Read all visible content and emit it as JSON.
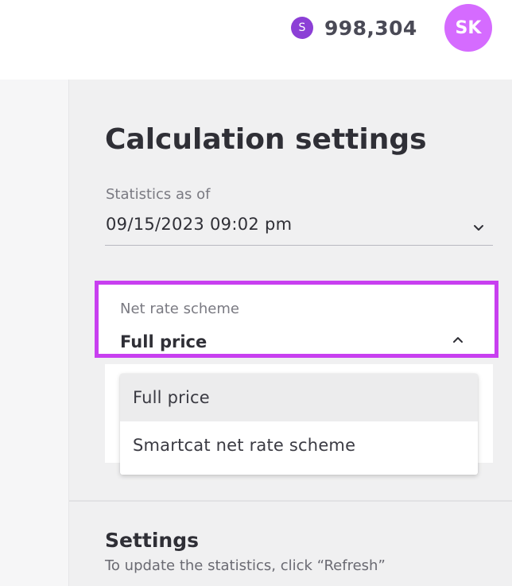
{
  "header": {
    "coin_symbol": "S",
    "balance": "998,304",
    "avatar_initials": "SK"
  },
  "panel": {
    "title": "Calculation settings",
    "statistics": {
      "label": "Statistics as of",
      "value": "09/15/2023 09:02 pm"
    },
    "net_rate": {
      "label": "Net rate scheme",
      "value": "Full price",
      "options": [
        "Full price",
        "Smartcat net rate scheme"
      ]
    },
    "settings": {
      "title": "Settings",
      "hint": "To update the statistics, click “Refresh”"
    }
  },
  "colors": {
    "coin": "#8c3fd6",
    "avatar": "#d56bff",
    "highlight_border": "#c83ff0",
    "panel_bg": "#f0f0f1"
  }
}
